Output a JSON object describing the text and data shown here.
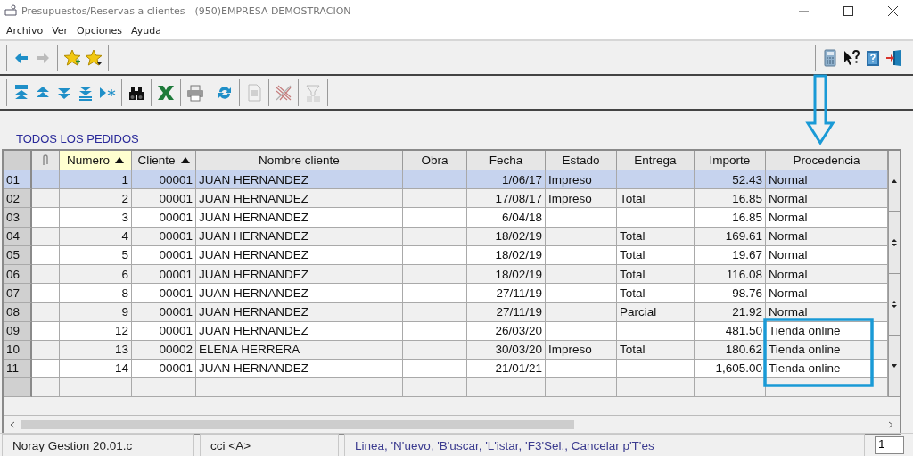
{
  "window": {
    "title": "Presupuestos/Reservas a clientes -  (950)EMPRESA DEMOSTRACION"
  },
  "menu": [
    "Archivo",
    "Ver",
    "Opciones",
    "Ayuda"
  ],
  "toolbar": [
    {
      "kind": "back",
      "disabled": false
    },
    {
      "kind": "forward",
      "disabled": true
    },
    {
      "kind": "star-add",
      "disabled": false
    },
    {
      "kind": "star-menu",
      "disabled": false
    }
  ],
  "toolbar_right": [
    {
      "kind": "calculator"
    },
    {
      "kind": "help-pointer"
    },
    {
      "kind": "help-book"
    },
    {
      "kind": "exit"
    }
  ],
  "navbar": [
    {
      "kind": "first",
      "disabled": false
    },
    {
      "kind": "prev",
      "disabled": false
    },
    {
      "kind": "next",
      "disabled": false
    },
    {
      "kind": "last",
      "disabled": false
    },
    {
      "kind": "new",
      "disabled": false
    },
    {
      "kind": "search",
      "disabled": false
    },
    {
      "kind": "excel",
      "disabled": false
    },
    {
      "kind": "print",
      "disabled": false
    },
    {
      "kind": "refresh",
      "disabled": false
    },
    {
      "kind": "document",
      "disabled": true
    },
    {
      "kind": "clear",
      "disabled": true
    },
    {
      "kind": "filter",
      "disabled": true
    }
  ],
  "section_title": "TODOS LOS PEDIDOS",
  "table": {
    "columns": [
      {
        "kind": "attachment"
      },
      {
        "kind": "number",
        "label": "Numero",
        "sorted": true,
        "active": true
      },
      {
        "kind": "number",
        "label": "Cliente",
        "sorted": true,
        "active": false
      },
      {
        "kind": "text",
        "label": "Nombre cliente",
        "sorted": false,
        "active": false
      },
      {
        "kind": "text",
        "label": "Obra",
        "sorted": false,
        "active": false
      },
      {
        "kind": "number",
        "label": "Fecha",
        "sorted": false,
        "active": false
      },
      {
        "kind": "text",
        "label": "Estado",
        "sorted": false,
        "active": false
      },
      {
        "kind": "text",
        "label": "Entrega",
        "sorted": false,
        "active": false
      },
      {
        "kind": "number",
        "label": "Importe",
        "sorted": false,
        "active": false
      },
      {
        "kind": "text",
        "label": "Procedencia",
        "sorted": false,
        "active": false
      }
    ],
    "rows": [
      {
        "row": "01",
        "selected": true,
        "cells": [
          null,
          "1",
          "00001",
          "JUAN HERNANDEZ",
          null,
          "1/06/17",
          "Impreso",
          null,
          "52.43",
          "Normal"
        ]
      },
      {
        "row": "02",
        "selected": false,
        "cells": [
          null,
          "2",
          "00001",
          "JUAN HERNANDEZ",
          null,
          "17/08/17",
          "Impreso",
          "Total",
          "16.85",
          "Normal"
        ]
      },
      {
        "row": "03",
        "selected": false,
        "cells": [
          null,
          "3",
          "00001",
          "JUAN HERNANDEZ",
          null,
          "6/04/18",
          null,
          null,
          "16.85",
          "Normal"
        ]
      },
      {
        "row": "04",
        "selected": false,
        "cells": [
          null,
          "4",
          "00001",
          "JUAN HERNANDEZ",
          null,
          "18/02/19",
          null,
          "Total",
          "169.61",
          "Normal"
        ]
      },
      {
        "row": "05",
        "selected": false,
        "cells": [
          null,
          "5",
          "00001",
          "JUAN HERNANDEZ",
          null,
          "18/02/19",
          null,
          "Total",
          "19.67",
          "Normal"
        ]
      },
      {
        "row": "06",
        "selected": false,
        "cells": [
          null,
          "6",
          "00001",
          "JUAN HERNANDEZ",
          null,
          "18/02/19",
          null,
          "Total",
          "116.08",
          "Normal"
        ]
      },
      {
        "row": "07",
        "selected": false,
        "cells": [
          null,
          "8",
          "00001",
          "JUAN HERNANDEZ",
          null,
          "27/11/19",
          null,
          "Total",
          "98.76",
          "Normal"
        ]
      },
      {
        "row": "08",
        "selected": false,
        "cells": [
          null,
          "9",
          "00001",
          "JUAN HERNANDEZ",
          null,
          "27/11/19",
          null,
          "Parcial",
          "21.92",
          "Normal"
        ]
      },
      {
        "row": "09",
        "selected": false,
        "cells": [
          null,
          "12",
          "00001",
          "JUAN HERNANDEZ",
          null,
          "26/03/20",
          null,
          null,
          "481.50",
          "Tienda online"
        ]
      },
      {
        "row": "10",
        "selected": false,
        "cells": [
          null,
          "13",
          "00002",
          "ELENA HERRERA",
          null,
          "30/03/20",
          "Impreso",
          "Total",
          "180.62",
          "Tienda online"
        ]
      },
      {
        "row": "11",
        "selected": false,
        "cells": [
          null,
          "14",
          "00001",
          "JUAN HERNANDEZ",
          null,
          "21/01/21",
          null,
          null,
          "1,605.00",
          "Tienda online"
        ]
      }
    ]
  },
  "status_bar": {
    "version": "Noray Gestion 20.01.c",
    "user": "cci <A>",
    "hint": "Linea, 'N'uevo, 'B'uscar, 'L'istar, 'F3'Sel., Cancelar p'T'es",
    "page": "1"
  }
}
